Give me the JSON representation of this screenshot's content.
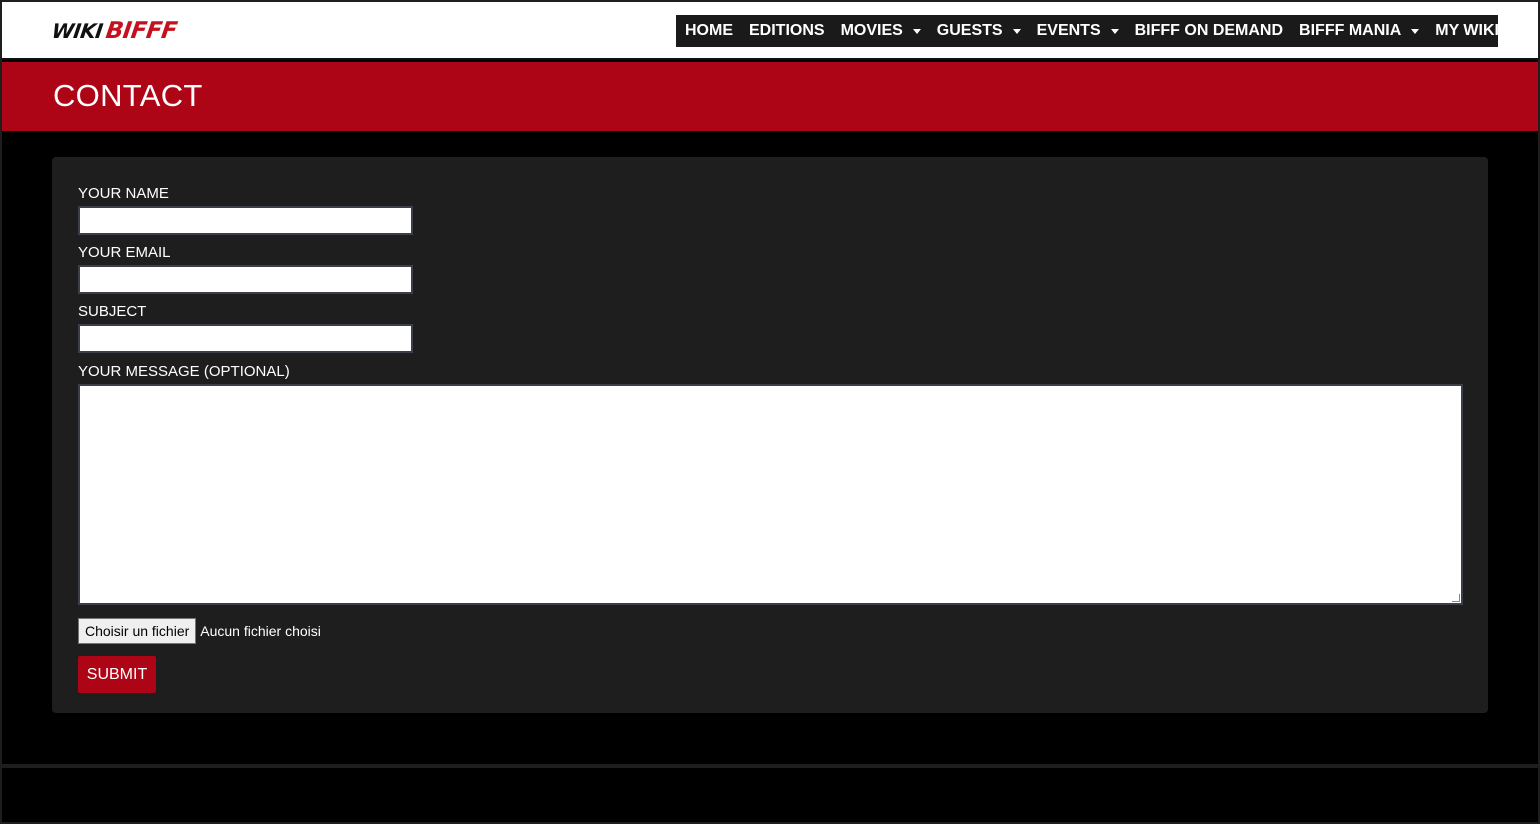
{
  "header": {
    "logo": {
      "wiki": "WIKI",
      "bifff": "BIFFF"
    },
    "nav": [
      {
        "label": "HOME",
        "has_dropdown": false
      },
      {
        "label": "EDITIONS",
        "has_dropdown": false
      },
      {
        "label": "MOVIES",
        "has_dropdown": true
      },
      {
        "label": "GUESTS",
        "has_dropdown": true
      },
      {
        "label": "EVENTS",
        "has_dropdown": true
      },
      {
        "label": "BIFFF ON DEMAND",
        "has_dropdown": false
      },
      {
        "label": "BIFFF MANIA",
        "has_dropdown": true
      },
      {
        "label": "MY WIKI",
        "has_dropdown": true
      }
    ]
  },
  "banner": {
    "title": "CONTACT"
  },
  "form": {
    "name_label": "YOUR NAME",
    "name_value": "",
    "email_label": "YOUR EMAIL",
    "email_value": "",
    "subject_label": "SUBJECT",
    "subject_value": "",
    "message_label": "YOUR MESSAGE (OPTIONAL)",
    "message_value": "",
    "file_button": "Choisir un fichier",
    "file_status": "Aucun fichier choisi",
    "submit_label": "SUBMIT"
  },
  "colors": {
    "accent_red": "#ae0516",
    "logo_red": "#c4101f",
    "nav_bg": "#1a1a1a",
    "card_bg": "#1e1e1e",
    "page_bg": "#000000"
  },
  "icons": {
    "dropdown": "caret-down-icon",
    "textarea_resize": "resize-grip-icon"
  }
}
